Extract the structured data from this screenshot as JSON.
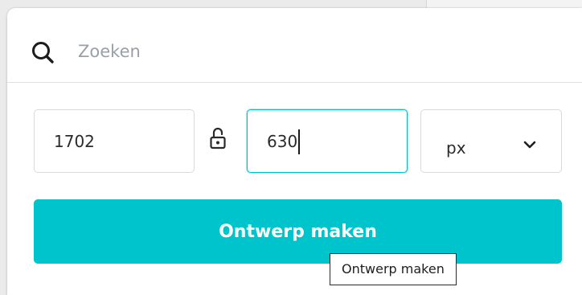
{
  "search": {
    "placeholder": "Zoeken",
    "value": ""
  },
  "dimensions": {
    "width": "1702",
    "height": "630",
    "lock_state": "unlocked"
  },
  "unit": {
    "selected": "px"
  },
  "create": {
    "label": "Ontwerp maken",
    "tooltip": "Ontwerp maken"
  },
  "colors": {
    "accent": "#00c4cc",
    "text": "#2b2b2b",
    "placeholder": "#9aa0a6",
    "border": "#d9d9d9"
  },
  "icons": [
    "search-icon",
    "lock-open-icon",
    "chevron-down-icon"
  ]
}
